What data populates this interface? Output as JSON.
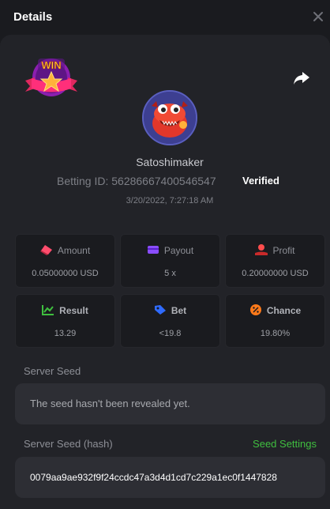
{
  "header": {
    "title": "Details"
  },
  "badge": {
    "text": "WIN"
  },
  "profile": {
    "username": "Satoshimaker",
    "betting_id": "Betting ID: 56286667400546547",
    "verified": "Verified",
    "datetime": "3/20/2022, 7:27:18 AM"
  },
  "stats": [
    {
      "label": "Amount",
      "value": "0.05000000 USD",
      "icon": "eraser-icon",
      "color": "#ff4d6d"
    },
    {
      "label": "Payout",
      "value": "5 x",
      "icon": "wallet-icon",
      "color": "#8a4dff"
    },
    {
      "label": "Profit",
      "value": "0.20000000 USD",
      "icon": "coin-hand-icon",
      "color": "#ff4d4d"
    },
    {
      "label": "Result",
      "value": "13.29",
      "icon": "chart-icon",
      "color": "#3fbf3f"
    },
    {
      "label": "Bet",
      "value": "<19.8",
      "icon": "tag-icon",
      "color": "#2f6bff"
    },
    {
      "label": "Chance",
      "value": "19.80%",
      "icon": "percent-icon",
      "color": "#ff7a1a"
    }
  ],
  "server_seed": {
    "label": "Server Seed",
    "value": "The seed hasn't been revealed yet."
  },
  "server_seed_hash": {
    "label": "Server Seed (hash)",
    "link": "Seed Settings",
    "value": "0079aa9ae932f9f24ccdc47a3d4d1cd7c229a1ec0f1447828"
  },
  "colors": {
    "background": "#1a1b1f",
    "panel": "#222328",
    "card": "#1a1b1f",
    "accent_green": "#3fbf3f"
  }
}
